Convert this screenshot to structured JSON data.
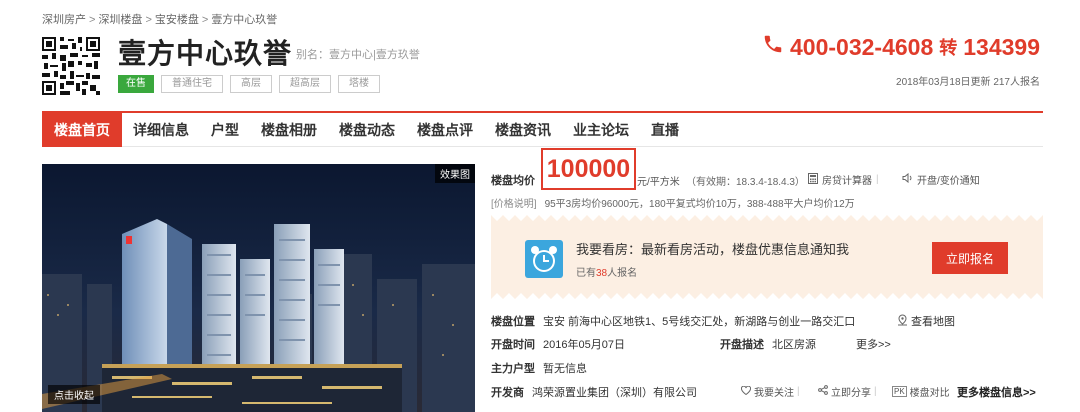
{
  "breadcrumb": [
    "深圳房产",
    "深圳楼盘",
    "宝安楼盘",
    "壹方中心玖誉"
  ],
  "breadcrumb_sep": ">",
  "header": {
    "title": "壹方中心玖誉",
    "alias": "别名：壹方中心|壹方玖誉",
    "tags": [
      "在售",
      "普通住宅",
      "高层",
      "超高层",
      "塔楼"
    ],
    "phone": "400-032-4608",
    "phone_ext_label": "转",
    "phone_ext": "134399",
    "update_date": "2018年03月18日更新",
    "signup_count": "217",
    "signup_suffix": "人报名"
  },
  "nav": {
    "items": [
      "楼盘首页",
      "详细信息",
      "户型",
      "楼盘相册",
      "楼盘动态",
      "楼盘点评",
      "楼盘资讯",
      "业主论坛",
      "直播"
    ]
  },
  "photo": {
    "badge": "效果图",
    "collapse": "点击收起"
  },
  "price": {
    "label": "楼盘均价",
    "value": "100000",
    "unit": "元/平方米",
    "validity": "（有效期：18.3.4-18.4.3）",
    "calculator": "房贷计算器",
    "notify": "开盘/变价通知",
    "note_label": "[价格说明]",
    "note": "95平3房均价96000元，180平复式均价10万，388-488平大户均价12万"
  },
  "promo": {
    "title": "我要看房：最新看房活动，楼盘优惠信息通知我",
    "sub_prefix": "已有",
    "sub_count": "38",
    "sub_suffix": "人报名",
    "button": "立即报名"
  },
  "details": {
    "location_label": "楼盘位置",
    "location": "宝安 前海中心区地铁1、5号线交汇处，新湖路与创业一路交汇口",
    "map_link": "查看地图",
    "open_label": "开盘时间",
    "open_date": "2016年05月07日",
    "open_desc_label": "开盘描述",
    "open_desc": "北区房源",
    "more": "更多>>",
    "unit_label": "主力户型",
    "unit": "暂无信息",
    "dev_label": "开发商",
    "developer": "鸿荣源置业集团（深圳）有限公司",
    "follow": "我要关注",
    "share": "立即分享",
    "compare": "楼盘对比",
    "more_info": "更多楼盘信息>>"
  },
  "colors": {
    "accent": "#e03c2b",
    "sale_tag": "#3aa83d",
    "promo_bg": "#fcefe3",
    "clock": "#3ba6dd"
  }
}
